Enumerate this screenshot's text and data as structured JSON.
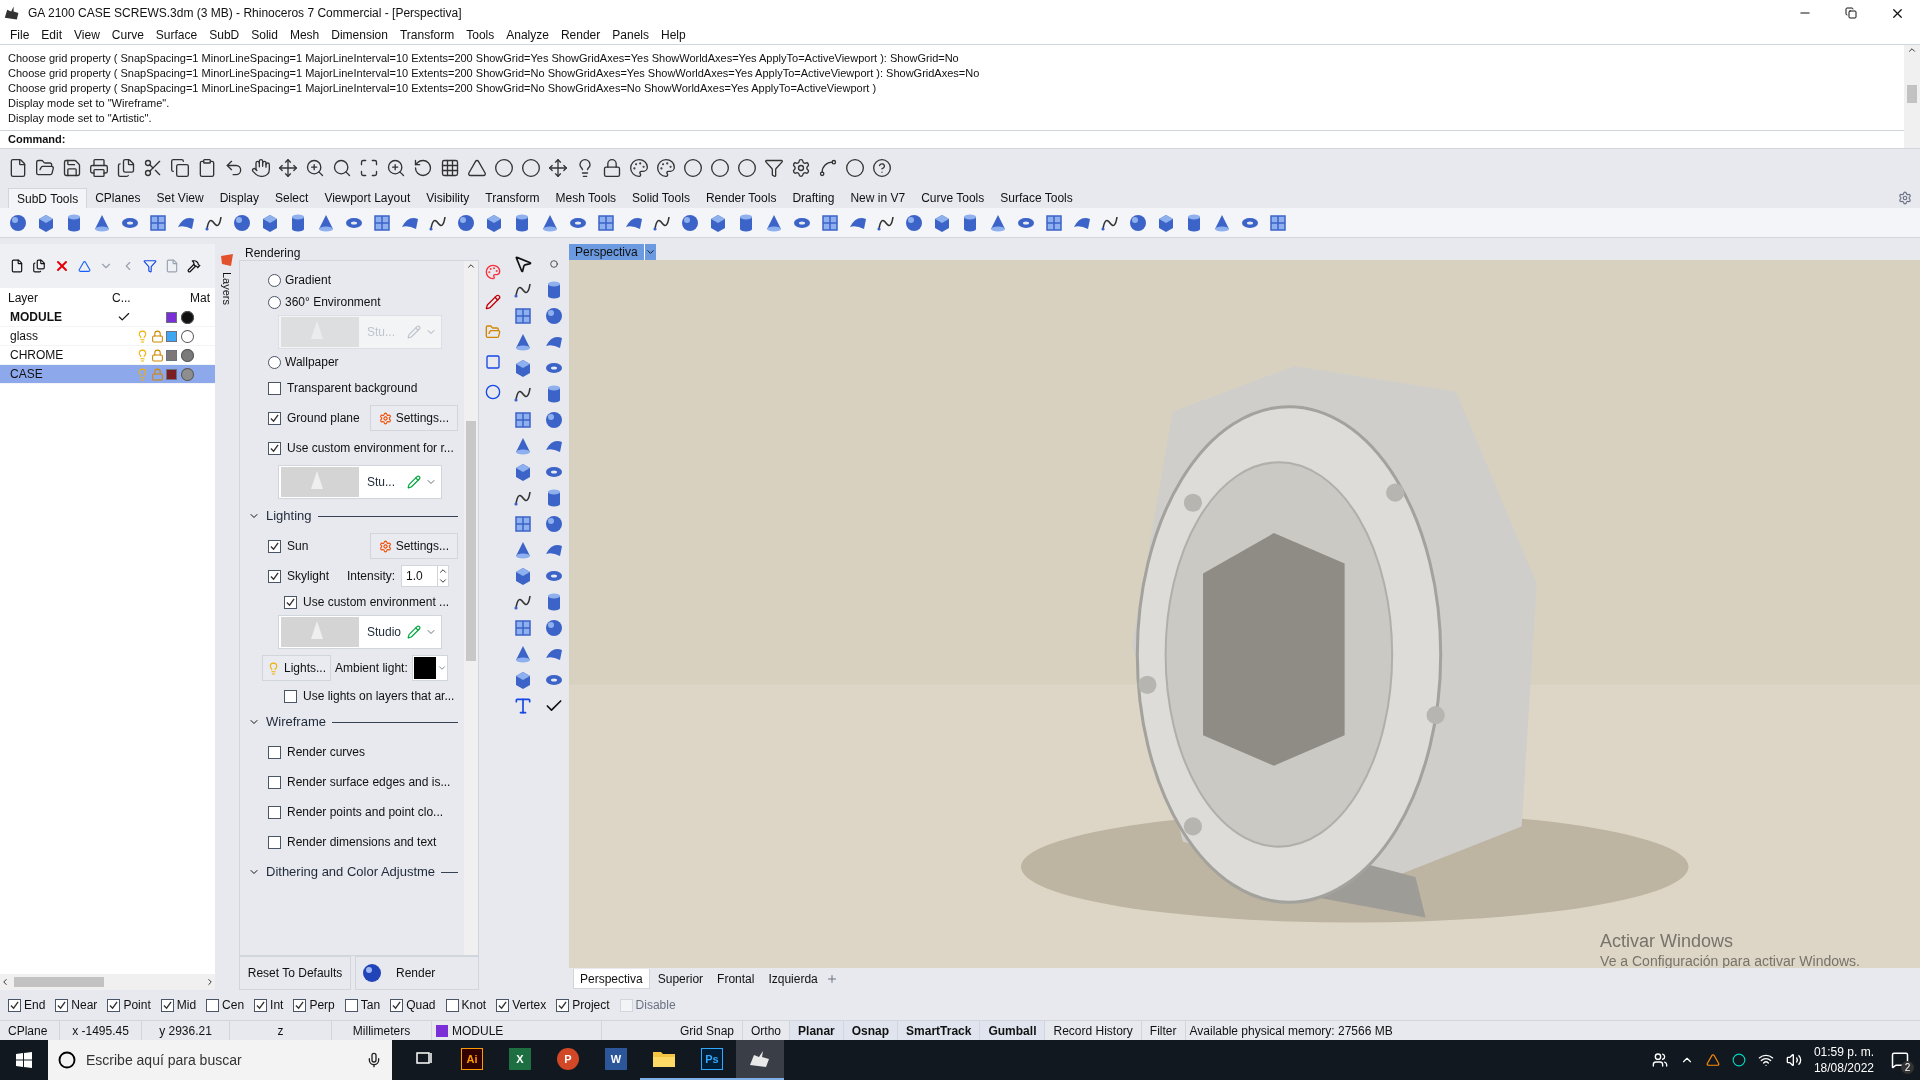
{
  "window": {
    "title": "GA 2100 CASE SCREWS.3dm (3 MB) - Rhinoceros 7 Commercial - [Perspectiva]"
  },
  "menu": [
    "File",
    "Edit",
    "View",
    "Curve",
    "Surface",
    "SubD",
    "Solid",
    "Mesh",
    "Dimension",
    "Transform",
    "Tools",
    "Analyze",
    "Render",
    "Panels",
    "Help"
  ],
  "command_history": [
    "Choose grid property ( SnapSpacing=1  MinorLineSpacing=1  MajorLineInterval=10  Extents=200  ShowGrid=Yes  ShowGridAxes=Yes  ShowWorldAxes=Yes  ApplyTo=ActiveViewport ): ShowGrid=No",
    "Choose grid property ( SnapSpacing=1  MinorLineSpacing=1  MajorLineInterval=10  Extents=200  ShowGrid=No  ShowGridAxes=Yes  ShowWorldAxes=Yes  ApplyTo=ActiveViewport ): ShowGridAxes=No",
    "Choose grid property ( SnapSpacing=1  MinorLineSpacing=1  MajorLineInterval=10  Extents=200  ShowGrid=No  ShowGridAxes=No  ShowWorldAxes=Yes  ApplyTo=ActiveViewport )",
    "Display mode set to \"Wireframe\".",
    "Display mode set to \"Artistic\"."
  ],
  "command_prompt": "Command:",
  "toolbar_tabs": [
    {
      "label": "SubD Tools",
      "selected": true
    },
    {
      "label": "CPlanes",
      "selected": false
    },
    {
      "label": "Set View",
      "selected": false
    },
    {
      "label": "Display",
      "selected": false
    },
    {
      "label": "Select",
      "selected": false
    },
    {
      "label": "Viewport Layout",
      "selected": false
    },
    {
      "label": "Visibility",
      "selected": false
    },
    {
      "label": "Transform",
      "selected": false
    },
    {
      "label": "Mesh Tools",
      "selected": false
    },
    {
      "label": "Solid Tools",
      "selected": false
    },
    {
      "label": "Render Tools",
      "selected": false
    },
    {
      "label": "Drafting",
      "selected": false
    },
    {
      "label": "New in V7",
      "selected": false
    },
    {
      "label": "Curve Tools",
      "selected": false
    },
    {
      "label": "Surface Tools",
      "selected": false
    }
  ],
  "layers_panel": {
    "tab_label": "Layers",
    "columns": [
      "Layer",
      "C...",
      "Mat"
    ],
    "layers": [
      {
        "name": "MODULE",
        "current": true,
        "selected": false,
        "color": "#7b2fd6",
        "material": {
          "color": "#111111"
        }
      },
      {
        "name": "glass",
        "current": false,
        "selected": false,
        "color": "#3ea6f2",
        "material": {
          "color": "#ffffff"
        }
      },
      {
        "name": "CHROME",
        "current": false,
        "selected": false,
        "color": "#7d7878",
        "material": {
          "color": "#7a7a7a"
        }
      },
      {
        "name": "CASE",
        "current": false,
        "selected": true,
        "color": "#7a1e24",
        "material": {
          "color": "#8e8e8e"
        }
      }
    ]
  },
  "rendering_panel": {
    "title": "Rendering",
    "rows": [
      {
        "kind": "radio",
        "label": "Gradient",
        "selected": false
      },
      {
        "kind": "radio",
        "label": "360° Environment",
        "selected": false
      },
      {
        "kind": "environment",
        "name": "Stu...",
        "disabled": true
      },
      {
        "kind": "radio",
        "label": "Wallpaper",
        "selected": false
      },
      {
        "kind": "checkbox",
        "label": "Transparent background",
        "checked": false
      },
      {
        "kind": "checkbox",
        "label": "Ground plane",
        "checked": true,
        "button": "Settings..."
      },
      {
        "kind": "checkbox",
        "label": "Use custom environment for r...",
        "checked": true
      },
      {
        "kind": "environment",
        "name": "Stu...",
        "disabled": false
      },
      {
        "kind": "section",
        "label": "Lighting",
        "expanded": true
      },
      {
        "kind": "checkbox",
        "label": "Sun",
        "checked": true,
        "button": "Settings..."
      },
      {
        "kind": "intensity",
        "label": "Skylight",
        "checked": true,
        "field_label": "Intensity:",
        "value": "1.0"
      },
      {
        "kind": "subcheckbox",
        "label": "Use custom environment ...",
        "checked": true
      },
      {
        "kind": "environment",
        "name": "Studio",
        "disabled": false
      },
      {
        "kind": "lights",
        "button": "Lights...",
        "label": "Ambient light:",
        "color": "#000000"
      },
      {
        "kind": "subcheckbox",
        "label": "Use lights on layers that ar...",
        "checked": false
      },
      {
        "kind": "section",
        "label": "Wireframe",
        "expanded": true
      },
      {
        "kind": "checkbox",
        "label": "Render curves",
        "checked": false
      },
      {
        "kind": "checkbox",
        "label": "Render surface edges and is...",
        "checked": false
      },
      {
        "kind": "checkbox",
        "label": "Render points and point clo...",
        "checked": false
      },
      {
        "kind": "checkbox",
        "label": "Render dimensions and text",
        "checked": false
      },
      {
        "kind": "section",
        "label": "Dithering and Color Adjustme",
        "expanded": true
      }
    ],
    "buttons": [
      "Reset To Defaults",
      "Render"
    ]
  },
  "viewport": {
    "label": "Perspectiva",
    "watermark": [
      "Activar Windows",
      "Ve a Configuración para activar Windows."
    ]
  },
  "viewport_tabs": [
    {
      "label": "Perspectiva",
      "selected": true
    },
    {
      "label": "Superior",
      "selected": false
    },
    {
      "label": "Frontal",
      "selected": false
    },
    {
      "label": "Izquierda",
      "selected": false
    }
  ],
  "osnaps": [
    {
      "label": "End",
      "checked": true,
      "disabled": false
    },
    {
      "label": "Near",
      "checked": true,
      "disabled": false
    },
    {
      "label": "Point",
      "checked": true,
      "disabled": false
    },
    {
      "label": "Mid",
      "checked": true,
      "disabled": false
    },
    {
      "label": "Cen",
      "checked": false,
      "disabled": false
    },
    {
      "label": "Int",
      "checked": true,
      "disabled": false
    },
    {
      "label": "Perp",
      "checked": true,
      "disabled": false
    },
    {
      "label": "Tan",
      "checked": false,
      "disabled": false
    },
    {
      "label": "Quad",
      "checked": true,
      "disabled": false
    },
    {
      "label": "Knot",
      "checked": false,
      "disabled": false
    },
    {
      "label": "Vertex",
      "checked": true,
      "disabled": false
    },
    {
      "label": "Project",
      "checked": true,
      "disabled": false
    },
    {
      "label": "Disable",
      "checked": false,
      "disabled": true
    }
  ],
  "status_bar": {
    "cplane": "CPlane",
    "x": "x -1495.45",
    "y": "y 2936.21",
    "z": "z",
    "units": "Millimeters",
    "layer": {
      "name": "MODULE",
      "color": "#7b2fd6"
    },
    "toggles": [
      {
        "label": "Grid Snap",
        "on": false
      },
      {
        "label": "Ortho",
        "on": false
      },
      {
        "label": "Planar",
        "on": true
      },
      {
        "label": "Osnap",
        "on": true
      },
      {
        "label": "SmartTrack",
        "on": true
      },
      {
        "label": "Gumball",
        "on": true
      },
      {
        "label": "Record History",
        "on": false
      },
      {
        "label": "Filter",
        "on": false
      }
    ],
    "memory": "Available physical memory: 27566 MB"
  },
  "taskbar": {
    "search_placeholder": "Escribe aquí para buscar",
    "apps": [
      {
        "kind": "taskview",
        "open": false,
        "active": false
      },
      {
        "kind": "illustrator",
        "label": "Ai",
        "open": false,
        "active": false
      },
      {
        "kind": "excel",
        "label": "X",
        "open": false,
        "active": false
      },
      {
        "kind": "powerpoint",
        "label": "P",
        "open": false,
        "active": false
      },
      {
        "kind": "word",
        "label": "W",
        "open": false,
        "active": false
      },
      {
        "kind": "explorer",
        "open": true,
        "active": false
      },
      {
        "kind": "photoshop",
        "label": "Ps",
        "open": true,
        "active": false
      },
      {
        "kind": "rhino",
        "open": true,
        "active": true
      }
    ],
    "time": "01:59 p. m.",
    "date": "18/08/2022",
    "notifications": "2"
  }
}
